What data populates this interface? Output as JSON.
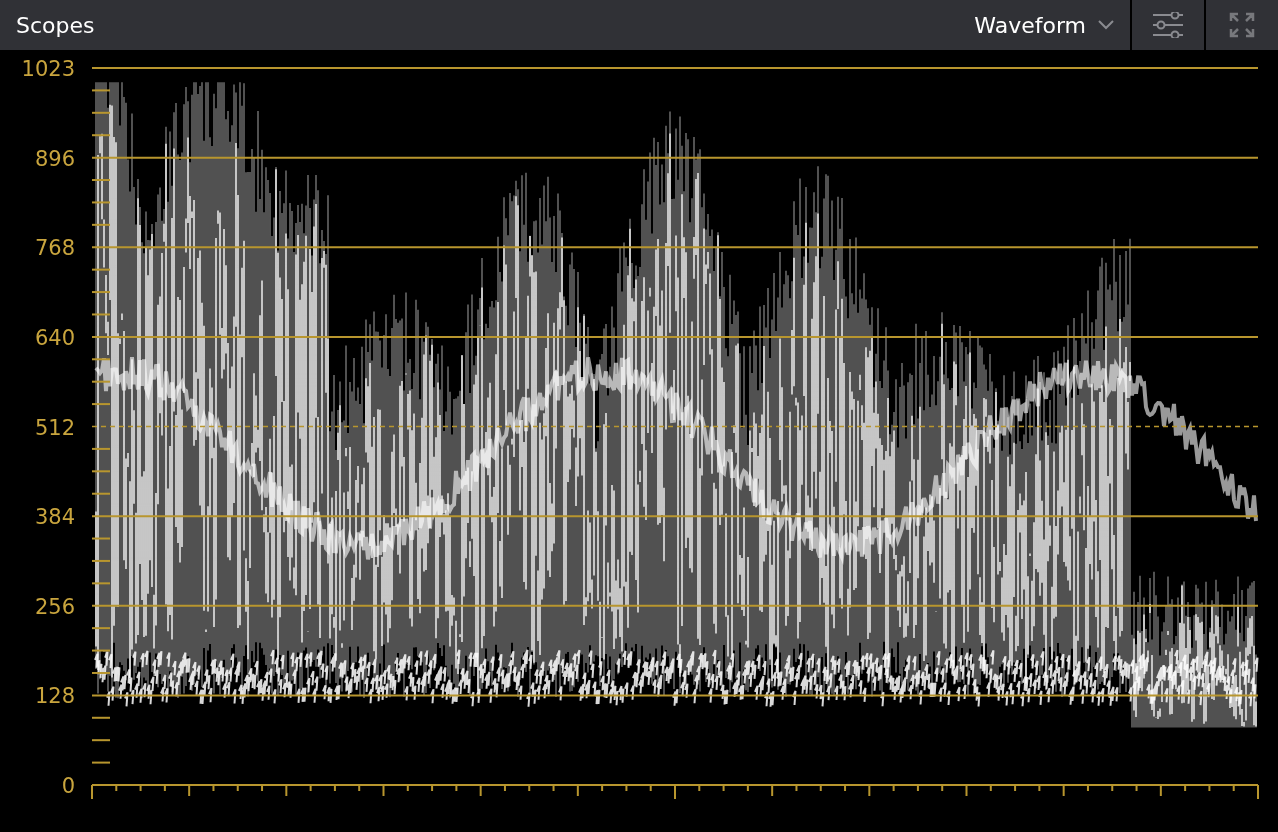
{
  "panel": {
    "title": "Scopes"
  },
  "scope_selector": {
    "value": "Waveform"
  },
  "scale": {
    "labels": [
      {
        "text": "1023",
        "kind": "gridline"
      },
      {
        "text": "896",
        "kind": "gridline"
      },
      {
        "text": "768",
        "kind": "gridline"
      },
      {
        "text": "640",
        "kind": "gridline"
      },
      {
        "text": "512",
        "kind": "dashed"
      },
      {
        "text": "384",
        "kind": "gridline"
      },
      {
        "text": "256",
        "kind": "gridline"
      },
      {
        "text": "128",
        "kind": "gridline"
      },
      {
        "text": "0",
        "kind": "axis"
      }
    ]
  }
}
